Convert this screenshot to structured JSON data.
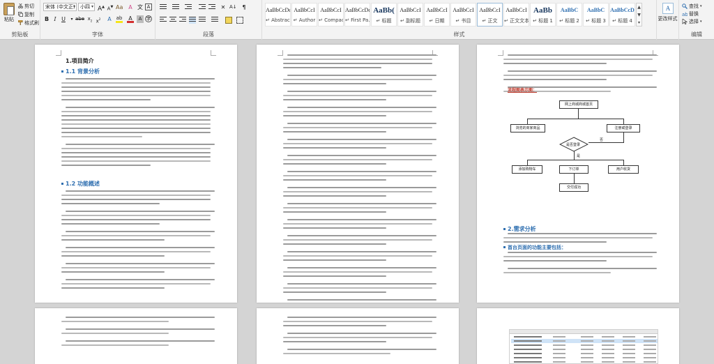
{
  "ribbon": {
    "clipboard": {
      "group_label": "剪贴板",
      "paste": "粘贴",
      "cut": "剪切",
      "copy": "复制",
      "format_painter": "格式刷"
    },
    "font": {
      "group_label": "字体",
      "font_name": "宋体 (中文正)",
      "font_size": "小四"
    },
    "paragraph": {
      "group_label": "段落"
    },
    "styles": {
      "group_label": "样式",
      "tiles": [
        {
          "sample": "AaBbCcDd",
          "name": "↵ Abstract"
        },
        {
          "sample": "AaBbCcI",
          "name": "↵ Author"
        },
        {
          "sample": "AaBbCcI",
          "name": "↵ Compact"
        },
        {
          "sample": "AaBbCcDd",
          "name": "↵ First Pa..."
        },
        {
          "sample": "AaBb(",
          "name": "↵ 标题"
        },
        {
          "sample": "AaBbCcI",
          "name": "↵ 副标题"
        },
        {
          "sample": "AaBbCcI",
          "name": "↵ 日期"
        },
        {
          "sample": "AaBbCcI",
          "name": "↵ 书目"
        },
        {
          "sample": "AaBbCcI",
          "name": "↵ 正文"
        },
        {
          "sample": "AaBbCcI",
          "name": "↵ 正文文本"
        },
        {
          "sample": "AaBb",
          "name": "↵ 标题 1"
        },
        {
          "sample": "AaBbC",
          "name": "↵ 标题 2"
        },
        {
          "sample": "AaBbC",
          "name": "↵ 标题 3"
        },
        {
          "sample": "AaBbCcD",
          "name": "↵ 标题 4"
        }
      ],
      "change_styles": "更改样式"
    },
    "editing": {
      "group_label": "编辑",
      "find": "查找",
      "replace": "替换",
      "select": "选择"
    }
  },
  "page1": {
    "h_project": "1.项目简介",
    "h_background": "1.1 背景分析",
    "h_function": "1.2 功能概述"
  },
  "page3": {
    "h_flow_title": "流程图表示图：",
    "h_requirements": "2.需求分析",
    "h_home": "首台页面的功能主要包括：",
    "flowchart": {
      "start": "网上商城商城首页",
      "browse": "浏览的商家商品",
      "login": "注册或登录",
      "decision": "是否登录",
      "no": "否",
      "yes": "是",
      "cart": "添加购物车",
      "order": "下订单",
      "confirm": "用户收货",
      "end": "交付成功"
    }
  },
  "colors": {
    "heading_blue": "#2f6fb0",
    "red_heading": "#c0392b",
    "page_bg": "#ffffff",
    "workspace_bg": "#d4d4d4"
  }
}
